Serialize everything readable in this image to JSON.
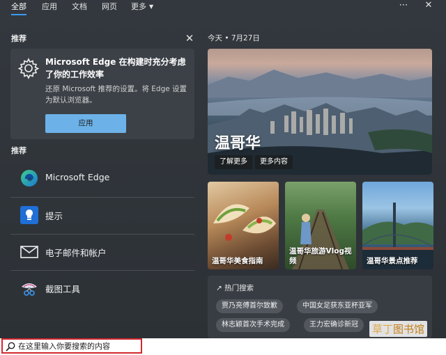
{
  "tabs": [
    {
      "label": "全部"
    },
    {
      "label": "应用"
    },
    {
      "label": "文档"
    },
    {
      "label": "网页"
    },
    {
      "label": "更多"
    }
  ],
  "top_icons": {
    "more": "⋯",
    "close": "✕"
  },
  "left": {
    "recommend_label": "推荐",
    "promo": {
      "title": "Microsoft Edge 在构建时充分考虑了你的工作效率",
      "desc": "还原 Microsoft 推荐的设置。将 Edge 设置为默认浏览器。",
      "button": "应用"
    },
    "apps_label": "推荐",
    "apps": [
      {
        "label": "Microsoft Edge",
        "icon": "edge-icon"
      },
      {
        "label": "提示",
        "icon": "tips-icon"
      },
      {
        "label": "电子邮件和帐户",
        "icon": "mail-icon"
      },
      {
        "label": "截图工具",
        "icon": "snipping-tool-icon"
      }
    ]
  },
  "right": {
    "date": "今天 • 7月27日",
    "hero": {
      "title": "温哥华",
      "btn_learn": "了解更多",
      "btn_more": "更多内容"
    },
    "cards": [
      {
        "caption": "温哥华美食指南"
      },
      {
        "caption": "温哥华旅游Vlog视频"
      },
      {
        "caption": "温哥华景点推荐"
      }
    ],
    "hot": {
      "title": "热门搜索",
      "chips": [
        "贾乃亮傅首尔致歉",
        "中国女足获东亚杯亚军",
        "林志颖首次手术完成",
        "王力宏确诊新冠"
      ]
    }
  },
  "watermark": {
    "a": "草丁",
    "b": "图书馆"
  },
  "search": {
    "placeholder": "在这里输入你要搜索的内容"
  },
  "colors": {
    "accent": "#3b9bf5",
    "apply_button": "#6cb2e8",
    "search_border": "#d3282e"
  }
}
